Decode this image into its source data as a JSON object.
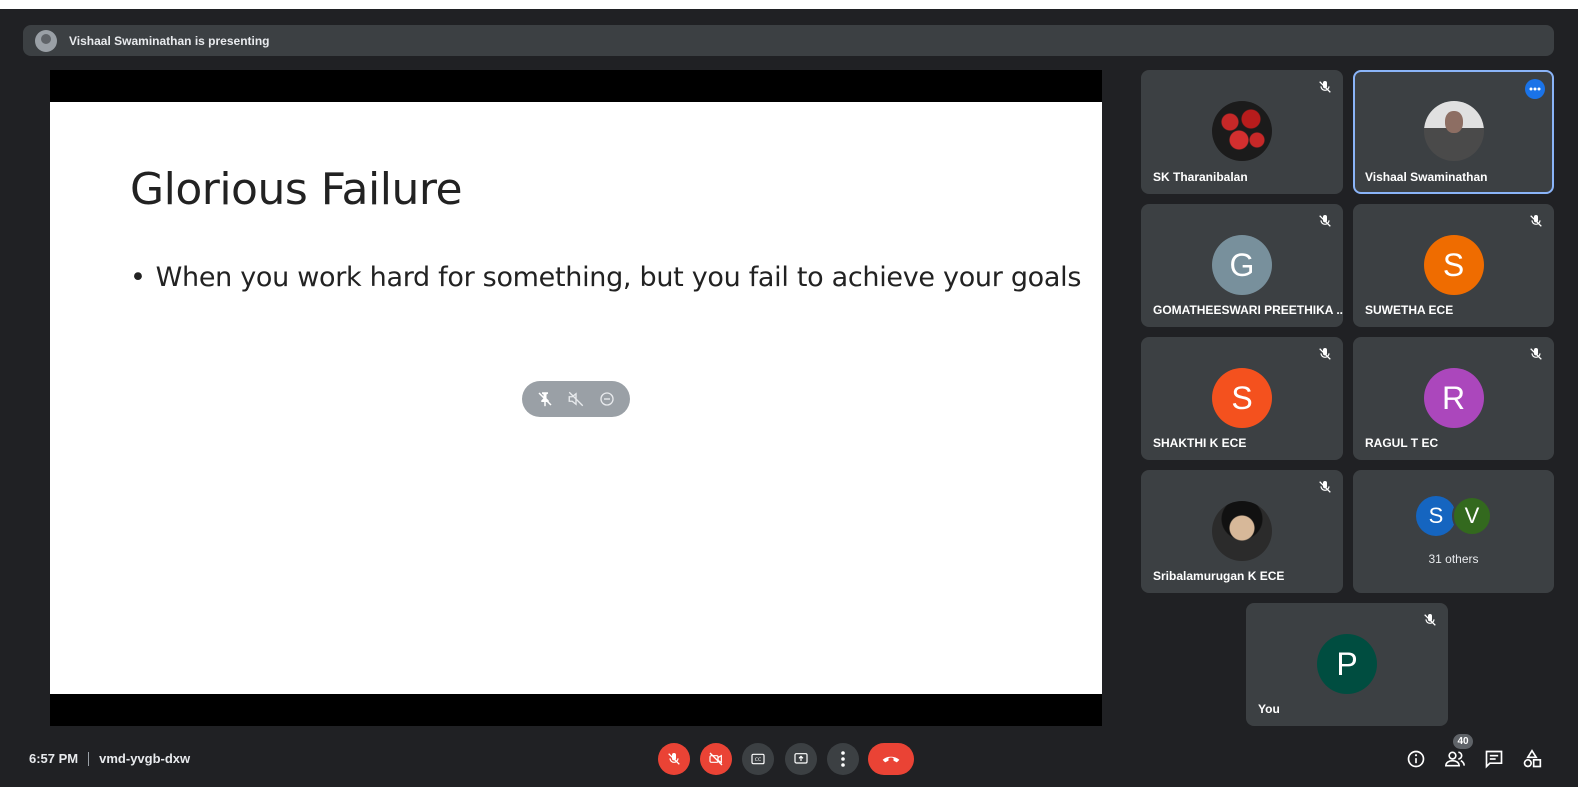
{
  "banner": {
    "text": "Vishaal Swaminathan is presenting"
  },
  "slide": {
    "title": "Glorious Failure",
    "bullets": [
      "When you work hard for something, but you fail to achieve your goals"
    ]
  },
  "participants": [
    {
      "name": "SK Tharanibalan",
      "avatar": "photo-strawberries",
      "muted": true
    },
    {
      "name": "Vishaal Swaminathan",
      "avatar": "photo-person",
      "active": true
    },
    {
      "name": "GOMATHEESWARI PREETHIKA ...",
      "initial": "G",
      "color": "#78909c",
      "muted": true
    },
    {
      "name": "SUWETHA ECE",
      "initial": "S",
      "color": "#ef6c00",
      "muted": true
    },
    {
      "name": "SHAKTHI K ECE",
      "initial": "S",
      "color": "#f4511e",
      "muted": true
    },
    {
      "name": "RAGUL T EC",
      "initial": "R",
      "color": "#ab47bc",
      "muted": true
    },
    {
      "name": "Sribalamurugan K ECE",
      "avatar": "photo-anime",
      "muted": true
    },
    {
      "others_label": "31 others",
      "initials": [
        "S",
        "V"
      ]
    },
    {
      "name": "You",
      "initial": "P",
      "color": "#004d40",
      "muted": true
    }
  ],
  "bottom": {
    "time": "6:57 PM",
    "meeting_code": "vmd-yvgb-dxw",
    "people_count": "40"
  },
  "colors": {
    "background": "#202124",
    "tile": "#3c4043",
    "danger": "#ea4335",
    "accent": "#8ab4f8"
  }
}
